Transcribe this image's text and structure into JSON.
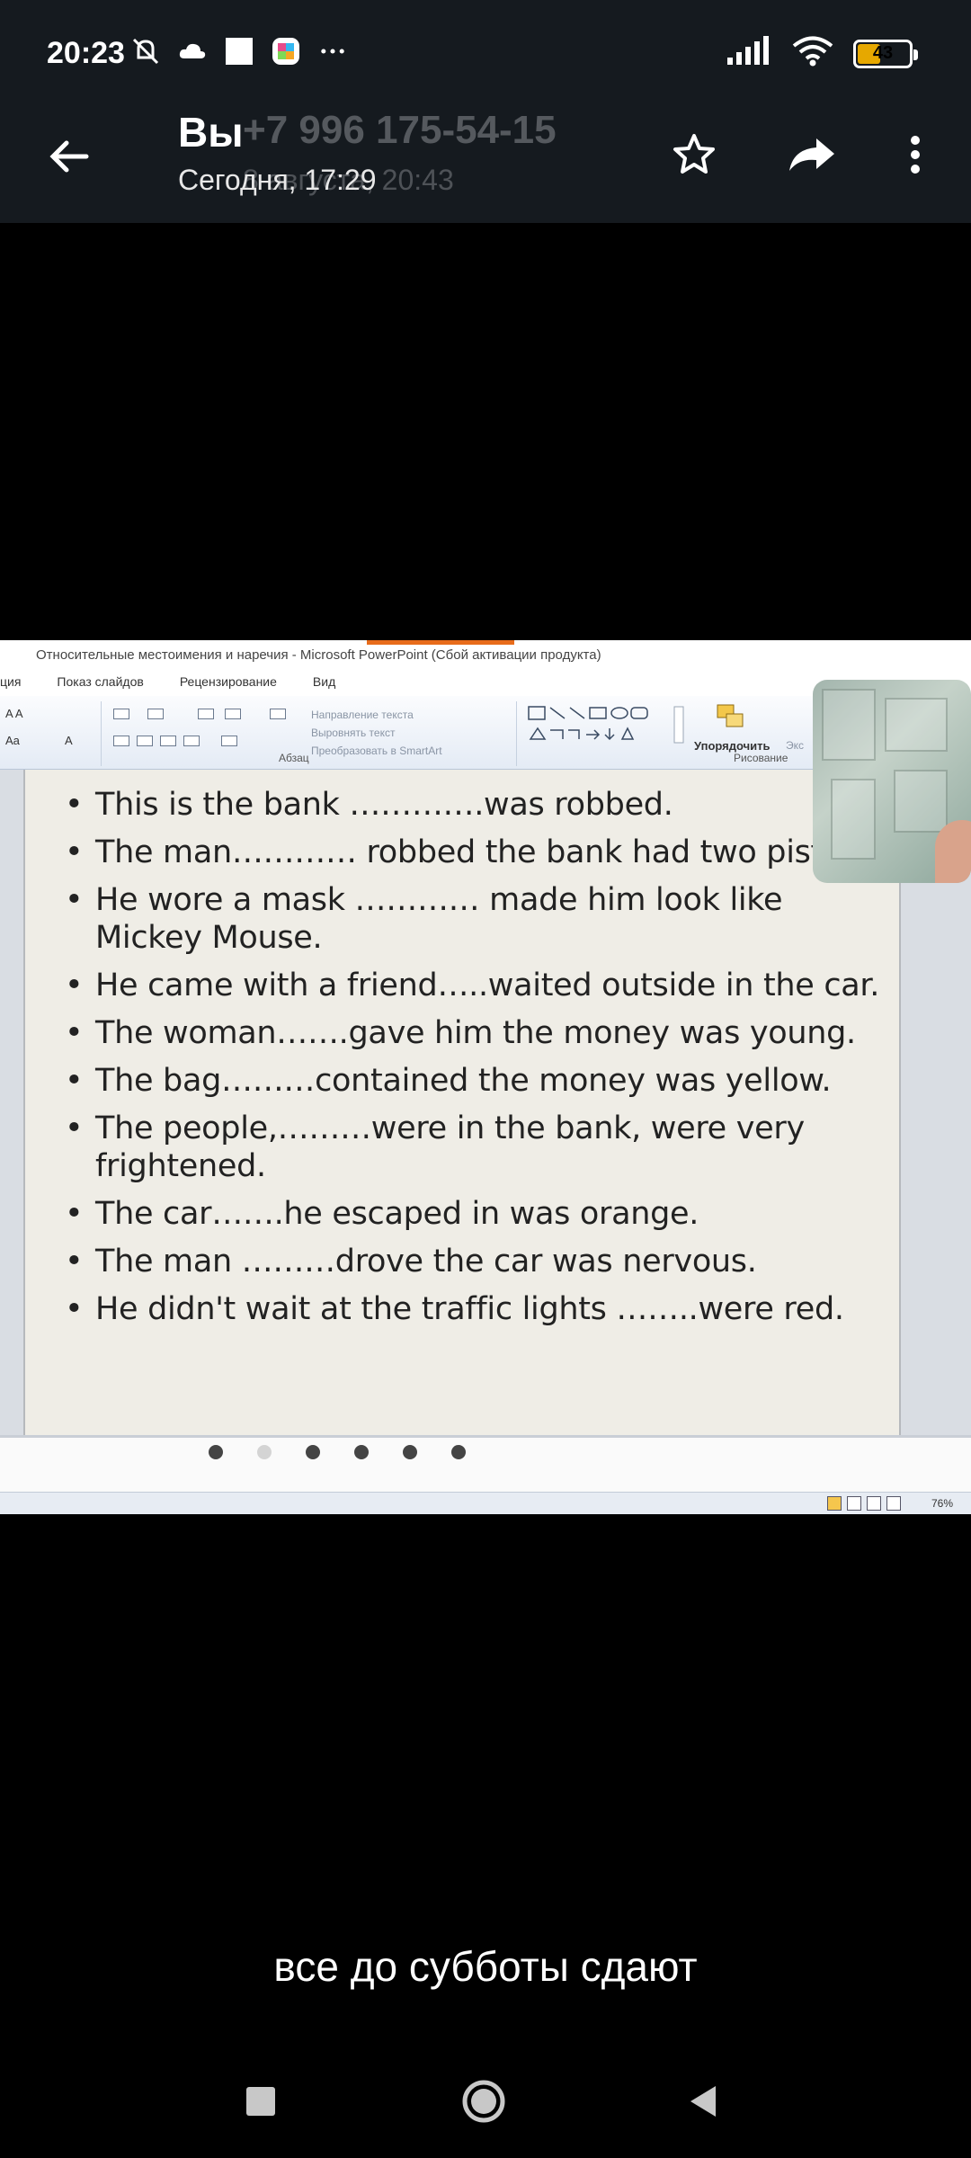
{
  "status_bar": {
    "time": "20:23",
    "battery": "43",
    "battery_level": 0.43,
    "icons": [
      "mute-icon",
      "cloud-icon",
      "notification-icon",
      "app-icon",
      "more-dots-icon",
      "signal-icon",
      "wifi-icon",
      "battery-icon"
    ]
  },
  "header": {
    "contact_name": "Вы",
    "contact_ghost": "+7 996 175-54-15",
    "date": "Сегодня, 17:29",
    "date_ghost": "8 августа, 20:43",
    "icons": [
      "back-arrow-icon",
      "star-icon",
      "share-icon",
      "more-vert-icon"
    ]
  },
  "ppt": {
    "window_title": "Относительные местоимения и наречия - Microsoft PowerPoint (Сбой активации продукта)",
    "tabs": [
      "ция",
      "Показ слайдов",
      "Рецензирование",
      "Вид"
    ],
    "ribbon": {
      "paragraph_group": "Абзац",
      "drawing_group": "Рисование",
      "text_direction": "Направление текста",
      "align_text": "Выровнять текст",
      "smartart": "Преобразовать в SmartArt",
      "arrange": "Упорядочить",
      "express": "Экс",
      "font_grow": "A A",
      "font_color": "Aa",
      "font_a": "A"
    },
    "bullets": [
      "This is the bank  ………….was robbed.",
      "The man…………  robbed the bank had two pistols.",
      "He wore a mask ………… made him look like Mickey Mouse.",
      "He came with a friend…..waited outside in the car.",
      "The woman…….gave him the money was young.",
      "The bag………contained the money was yellow.",
      "The people,………were in the bank, were very frightened.",
      "The car…….he escaped in was orange.",
      "The man ………drove the car was nervous.",
      "He didn't wait at the traffic lights ……..were red."
    ],
    "zoom": "76%"
  },
  "caption": "все до субботы сдают",
  "nav": {
    "icons": [
      "recent-apps-icon",
      "home-icon",
      "back-triangle-icon"
    ]
  }
}
